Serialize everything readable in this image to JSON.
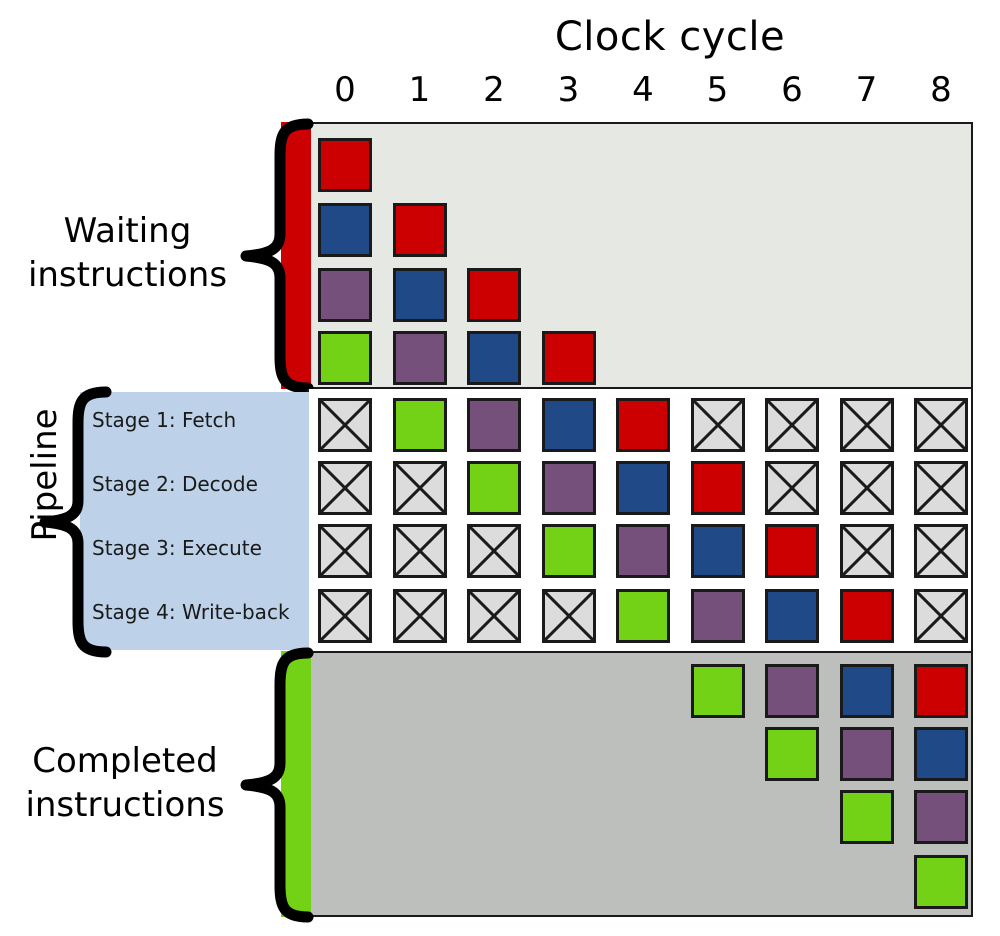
{
  "title": "Clock cycle",
  "columns": [
    "0",
    "1",
    "2",
    "3",
    "4",
    "5",
    "6",
    "7",
    "8"
  ],
  "sections": {
    "waiting": {
      "label_line1": "Waiting",
      "label_line2": "instructions",
      "accent_color": "#cc0000",
      "panel_color": "#e6e8e4"
    },
    "pipeline": {
      "label": "Pipeline",
      "panel_color": "#bdd2e9",
      "stages": [
        "Stage 1: Fetch",
        "Stage 2: Decode",
        "Stage 3: Execute",
        "Stage 4: Write-back"
      ]
    },
    "completed": {
      "label_line1": "Completed",
      "label_line2": "instructions",
      "accent_color": "#73d216",
      "panel_color": "#bcbfbb"
    }
  },
  "colors": {
    "red": "#cc0000",
    "blue": "#204a87",
    "purple": "#75507b",
    "green": "#73d216",
    "empty": "#dcdcdc",
    "outline": "#1a1a1a"
  },
  "chart_data": {
    "type": "table",
    "title": "Clock cycle",
    "xlabel": "Clock cycle",
    "ylabel": "",
    "categories": [
      "0",
      "1",
      "2",
      "3",
      "4",
      "5",
      "6",
      "7",
      "8"
    ],
    "legend": [
      "instruction-red",
      "instruction-blue",
      "instruction-purple",
      "instruction-green"
    ],
    "grid": {
      "waiting_rows": [
        [
          "red",
          "",
          "",
          "",
          "",
          "",
          "",
          "",
          ""
        ],
        [
          "blue",
          "red",
          "",
          "",
          "",
          "",
          "",
          "",
          ""
        ],
        [
          "purple",
          "blue",
          "red",
          "",
          "",
          "",
          "",
          "",
          ""
        ],
        [
          "green",
          "purple",
          "blue",
          "red",
          "",
          "",
          "",
          "",
          ""
        ]
      ],
      "pipeline_rows": [
        [
          "empty",
          "green",
          "purple",
          "blue",
          "red",
          "empty",
          "empty",
          "empty",
          "empty"
        ],
        [
          "empty",
          "empty",
          "green",
          "purple",
          "blue",
          "red",
          "empty",
          "empty",
          "empty"
        ],
        [
          "empty",
          "empty",
          "empty",
          "green",
          "purple",
          "blue",
          "red",
          "empty",
          "empty"
        ],
        [
          "empty",
          "empty",
          "empty",
          "empty",
          "green",
          "purple",
          "blue",
          "red",
          "empty"
        ]
      ],
      "completed_rows": [
        [
          "",
          "",
          "",
          "",
          "",
          "green",
          "purple",
          "blue",
          "red"
        ],
        [
          "",
          "",
          "",
          "",
          "",
          "",
          "green",
          "purple",
          "blue"
        ],
        [
          "",
          "",
          "",
          "",
          "",
          "",
          "",
          "green",
          "purple"
        ],
        [
          "",
          "",
          "",
          "",
          "",
          "",
          "",
          "",
          "green"
        ]
      ]
    }
  }
}
